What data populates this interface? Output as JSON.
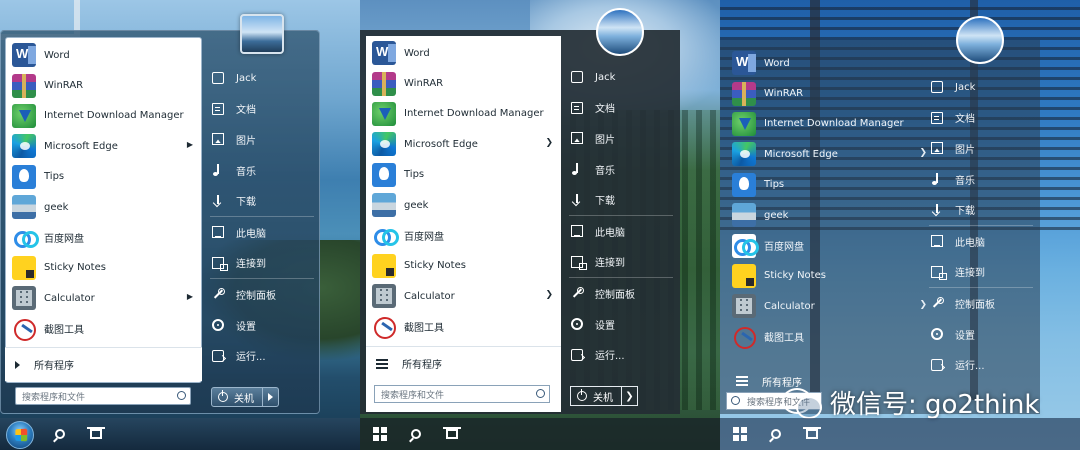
{
  "menu": {
    "programs": [
      {
        "label": "Word",
        "icon": "word-icon",
        "submenu": false
      },
      {
        "label": "WinRAR",
        "icon": "winrar-icon",
        "submenu": false
      },
      {
        "label": "Internet Download Manager",
        "icon": "idm-icon",
        "submenu": false
      },
      {
        "label": "Microsoft Edge",
        "icon": "edge-icon",
        "submenu": true
      },
      {
        "label": "Tips",
        "icon": "tips-icon",
        "submenu": false
      },
      {
        "label": "geek",
        "icon": "geek-icon",
        "submenu": false
      },
      {
        "label": "百度网盘",
        "icon": "baidu-netdisk-icon",
        "submenu": false
      },
      {
        "label": "Sticky Notes",
        "icon": "sticky-notes-icon",
        "submenu": false
      },
      {
        "label": "Calculator",
        "icon": "calculator-icon",
        "submenu": true
      },
      {
        "label": "截图工具",
        "icon": "snipping-tool-icon",
        "submenu": false
      }
    ],
    "all_programs": "所有程序",
    "search_placeholder": "搜索程序和文件",
    "right_items": [
      {
        "label": "Jack",
        "icon": "user-icon"
      },
      {
        "label": "文档",
        "icon": "documents-icon"
      },
      {
        "label": "图片",
        "icon": "pictures-icon"
      },
      {
        "label": "音乐",
        "icon": "music-icon"
      },
      {
        "label": "下载",
        "icon": "downloads-icon"
      },
      {
        "label": "此电脑",
        "icon": "this-pc-icon"
      },
      {
        "label": "连接到",
        "icon": "connect-to-icon"
      },
      {
        "label": "控制面板",
        "icon": "control-panel-icon"
      },
      {
        "label": "设置",
        "icon": "settings-icon"
      },
      {
        "label": "运行...",
        "icon": "run-icon"
      }
    ],
    "shutdown_label": "关机"
  },
  "watermark": {
    "text": "微信号: go2think"
  },
  "colors": {
    "accent_word": "#2b5797",
    "menu_dark": "#242e34",
    "menu_blue": "#345a76"
  }
}
